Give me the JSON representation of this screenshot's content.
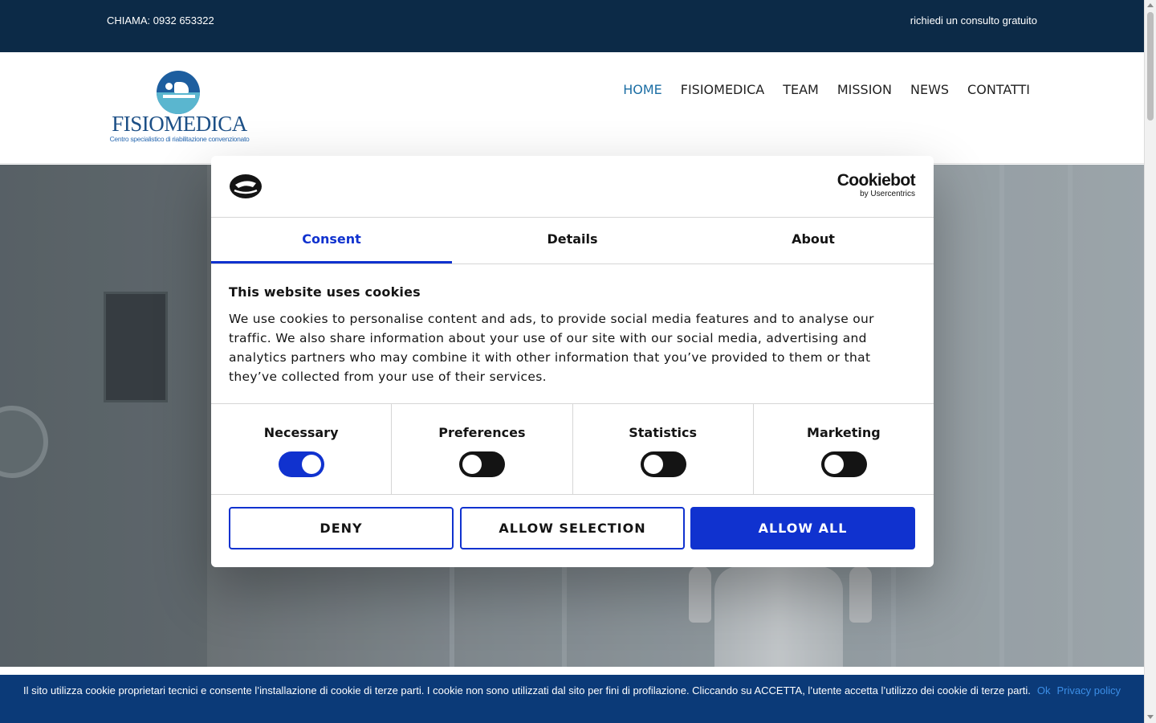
{
  "topbar": {
    "call": "CHIAMA: 0932 653322",
    "consult": "richiedi un consulto gratuito"
  },
  "logo": {
    "name": "FISIOMEDICA",
    "tagline": "Centro specialistico di riabilitazione convenzionato"
  },
  "nav": {
    "items": [
      {
        "label": "HOME",
        "active": true
      },
      {
        "label": "FISIOMEDICA",
        "active": false
      },
      {
        "label": "TEAM",
        "active": false
      },
      {
        "label": "MISSION",
        "active": false
      },
      {
        "label": "NEWS",
        "active": false
      },
      {
        "label": "CONTATTI",
        "active": false
      }
    ]
  },
  "dialog": {
    "brand": "Cookiebot",
    "brand_by": "by Usercentrics",
    "tabs": [
      {
        "label": "Consent",
        "active": true
      },
      {
        "label": "Details",
        "active": false
      },
      {
        "label": "About",
        "active": false
      }
    ],
    "title": "This website uses cookies",
    "body": "We use cookies to personalise content and ads, to provide social media features and to analyse our traffic. We also share information about your use of our site with our social media, advertising and analytics partners who may combine it with other information that you’ve provided to them or that they’ve collected from your use of their services.",
    "toggles": [
      {
        "label": "Necessary",
        "on": true
      },
      {
        "label": "Preferences",
        "on": false
      },
      {
        "label": "Statistics",
        "on": false
      },
      {
        "label": "Marketing",
        "on": false
      }
    ],
    "buttons": {
      "deny": "DENY",
      "allow_selection": "ALLOW SELECTION",
      "allow_all": "ALLOW ALL"
    }
  },
  "cookiebar": {
    "text": "Il sito utilizza cookie proprietari tecnici e consente l’installazione di cookie di terze parti. I cookie non sono utilizzati dal sito per fini di profilazione. Cliccando su ACCETTA, l’utente accetta l’utilizzo dei cookie di terze parti.",
    "ok": "Ok",
    "privacy": "Privacy policy"
  },
  "colors": {
    "topbar": "#0c2a47",
    "accent": "#1032cf",
    "nav_active": "#1c6ea4",
    "cookiebar": "#0b3a78"
  }
}
